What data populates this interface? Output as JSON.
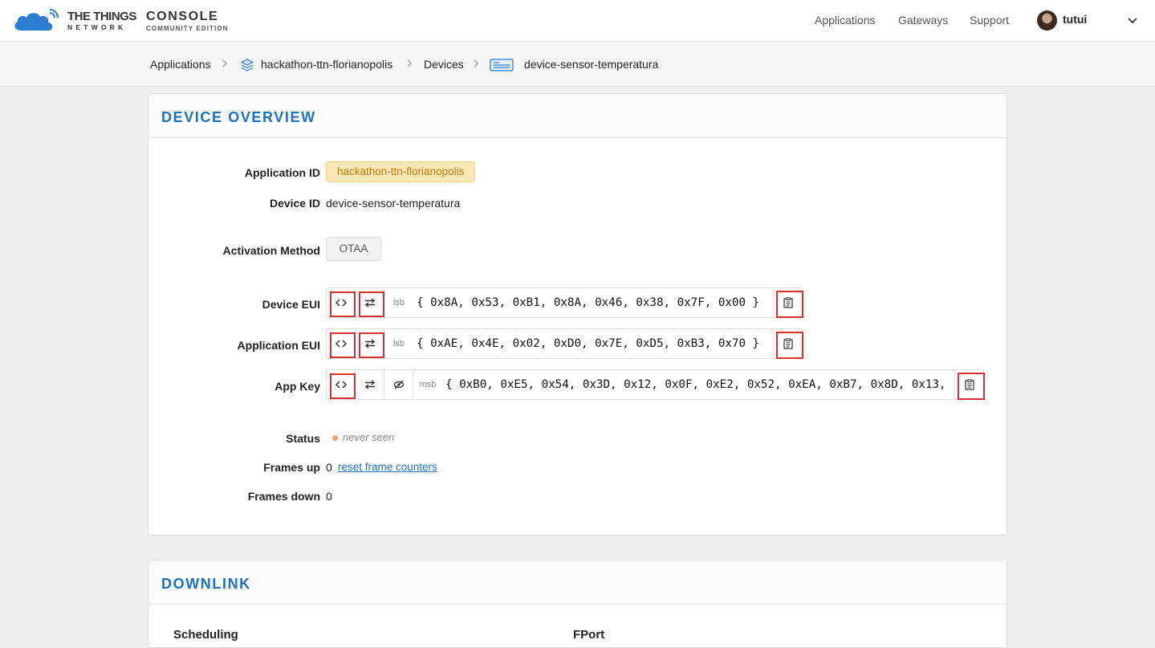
{
  "header": {
    "brand_line1": "THE THINGS",
    "brand_line2": "NETWORK",
    "console_line1": "CONSOLE",
    "console_line2": "COMMUNITY EDITION",
    "nav": [
      "Applications",
      "Gateways",
      "Support"
    ],
    "username": "tutui"
  },
  "breadcrumb": {
    "applications": "Applications",
    "app": "hackathon-ttn-florianopolis",
    "devices": "Devices",
    "device": "device-sensor-temperatura"
  },
  "overview": {
    "title": "DEVICE OVERVIEW",
    "application_id_label": "Application ID",
    "application_id": "hackathon-ttn-florianopolis",
    "device_id_label": "Device ID",
    "device_id": "device-sensor-temperatura",
    "activation_label": "Activation Method",
    "activation": "OTAA",
    "device_eui_label": "Device EUI",
    "device_eui_order": "lsb",
    "device_eui": "{ 0x8A, 0x53, 0xB1, 0x8A, 0x46, 0x38, 0x7F, 0x00 }",
    "app_eui_label": "Application EUI",
    "app_eui_order": "lsb",
    "app_eui": "{ 0xAE, 0x4E, 0x02, 0xD0, 0x7E, 0xD5, 0xB3, 0x70 }",
    "app_key_label": "App Key",
    "app_key_order": "msb",
    "app_key": "{ 0xB0, 0xE5, 0x54, 0x3D, 0x12, 0x0F, 0xE2, 0x52, 0xEA, 0xB7, 0x8D, 0x13,",
    "status_label": "Status",
    "status": "never seen",
    "status_color": "#f0a074",
    "frames_up_label": "Frames up",
    "frames_up": "0",
    "reset_link": "reset frame counters",
    "frames_down_label": "Frames down",
    "frames_down": "0"
  },
  "downlink": {
    "title": "DOWNLINK",
    "scheduling_label": "Scheduling",
    "fport_label": "FPort"
  },
  "colors": {
    "accent": "#1d72c0",
    "highlight": "#d93131",
    "badge_bg": "#fce7b6"
  },
  "icons": [
    "cloud-logo-icon",
    "chevron-down-icon",
    "layers-icon",
    "device-icon",
    "code-icon",
    "swap-icon",
    "eye-slash-icon",
    "clipboard-icon"
  ]
}
